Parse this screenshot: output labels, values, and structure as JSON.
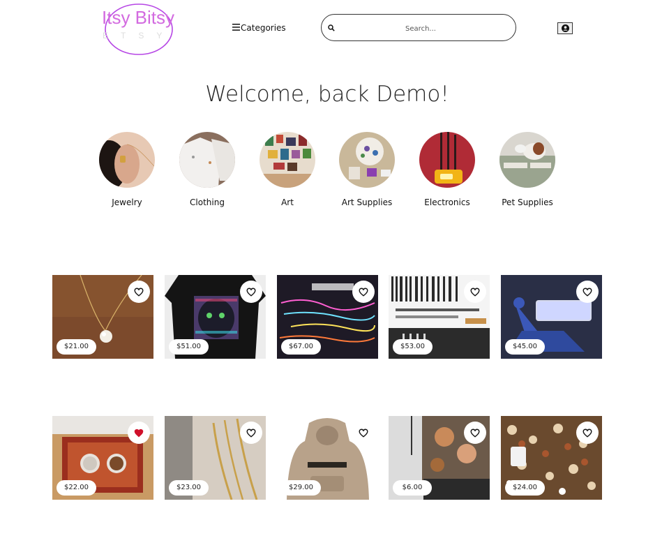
{
  "header": {
    "logo_text": "Itsy Bitsy",
    "logo_subtext": "ETSY",
    "categories_label": "Categories",
    "search_placeholder": "Search..."
  },
  "welcome_text": "Welcome, back Demo!",
  "categories": [
    {
      "label": "Jewelry"
    },
    {
      "label": "Clothing"
    },
    {
      "label": "Art"
    },
    {
      "label": "Art Supplies"
    },
    {
      "label": "Electronics"
    },
    {
      "label": "Pet Supplies"
    }
  ],
  "products": [
    {
      "price": "$21.00",
      "favorited": false
    },
    {
      "price": "$51.00",
      "favorited": false
    },
    {
      "price": "$67.00",
      "favorited": false
    },
    {
      "price": "$53.00",
      "favorited": false
    },
    {
      "price": "$45.00",
      "favorited": false
    },
    {
      "price": "$22.00",
      "favorited": true
    },
    {
      "price": "$23.00",
      "favorited": false
    },
    {
      "price": "$29.00",
      "favorited": false
    },
    {
      "price": "$6.00",
      "favorited": false
    },
    {
      "price": "$24.00",
      "favorited": false
    }
  ],
  "colors": {
    "brand": "#d36be0",
    "favorite_heart": "#d0112b"
  },
  "icons": {
    "menu": "hamburger-icon",
    "search": "search-icon",
    "user": "user-circle-icon",
    "favorite": "heart-icon"
  }
}
